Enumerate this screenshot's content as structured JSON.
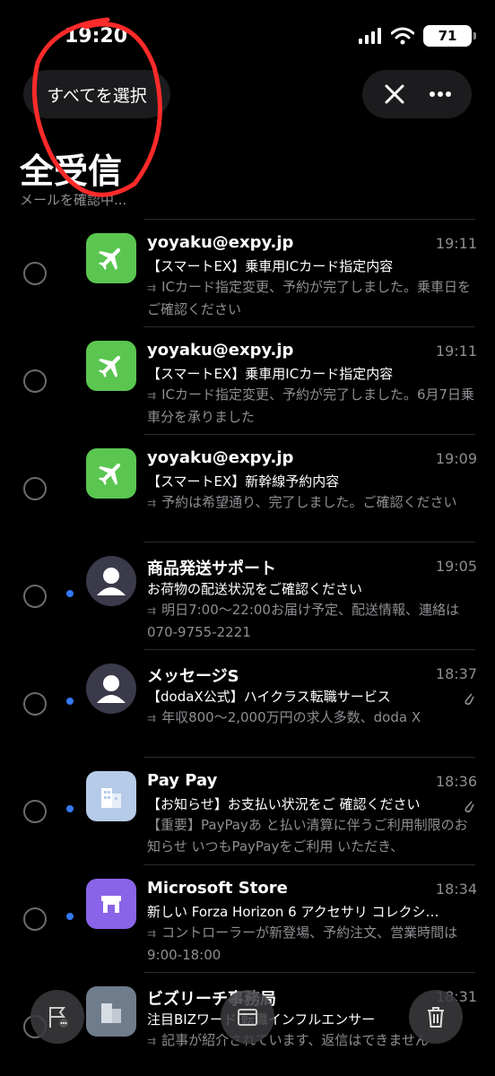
{
  "status": {
    "time": "19:20",
    "battery": "71"
  },
  "header": {
    "select_all": "すべてを選択",
    "title": "全受信",
    "subtitle": "メールを確認中..."
  },
  "colors": {
    "accent": "#3478f6",
    "app_green": "#5ac650",
    "annotation": "#ff2a2a"
  },
  "emails": [
    {
      "sender": "yoyaku@expy.jp",
      "time": "19:11",
      "subject": "【スマートEX】乗車用ICカード指定内容",
      "preview": "ICカード指定変更、予約が完了しました。乗車日をご確認ください",
      "icon": "airplane-icon",
      "unread": false,
      "attachment": false
    },
    {
      "sender": "yoyaku@expy.jp",
      "time": "19:11",
      "subject": "【スマートEX】乗車用ICカード指定内容",
      "preview": "ICカード指定変更、予約が完了しました。6月7日乗車分を承りました",
      "icon": "airplane-icon",
      "unread": false,
      "attachment": false
    },
    {
      "sender": "yoyaku@expy.jp",
      "time": "19:09",
      "subject": "【スマートEX】新幹線予約内容",
      "preview": "予約は希望通り、完了しました。ご確認ください",
      "icon": "airplane-icon",
      "unread": false,
      "attachment": false
    },
    {
      "sender": "商品発送サポート",
      "time": "19:05",
      "subject": "お荷物の配送状況をご確認ください",
      "preview": "明日7:00～22:00お届け予定、配送情報、連絡は070-9755-2221",
      "icon": "person-icon",
      "unread": true,
      "attachment": false
    },
    {
      "sender": "メッセージS",
      "time": "18:37",
      "subject": "【dodaX公式】ハイクラス転職サービス",
      "preview": "年収800～2,000万円の求人多数、doda X",
      "icon": "person-icon",
      "unread": true,
      "attachment": true
    },
    {
      "sender": "Pay Pay",
      "time": "18:36",
      "subject": "【お知らせ】お支払い状況をご 確認ください",
      "preview": "【重要】PayPayあ と払い清算に伴うご利用制限のお知らせ いつもPayPayをご利用 いただき、",
      "icon": "building-icon",
      "unread": true,
      "attachment": true
    },
    {
      "sender": "Microsoft Store",
      "time": "18:34",
      "subject": "新しい Forza Horizon 6 アクセサリ コレクシ…",
      "preview": "コントローラーが新登場、予約注文、営業時間は9:00-18:00",
      "icon": "store-icon",
      "unread": true,
      "attachment": false
    },
    {
      "sender": "ビズリーチ事務局",
      "time": "18:31",
      "subject": "注目BIZワード 転職インフルエンサー",
      "preview": "記事が紹介されています、返信はできません",
      "icon": "building-icon",
      "unread": false,
      "attachment": false
    }
  ]
}
